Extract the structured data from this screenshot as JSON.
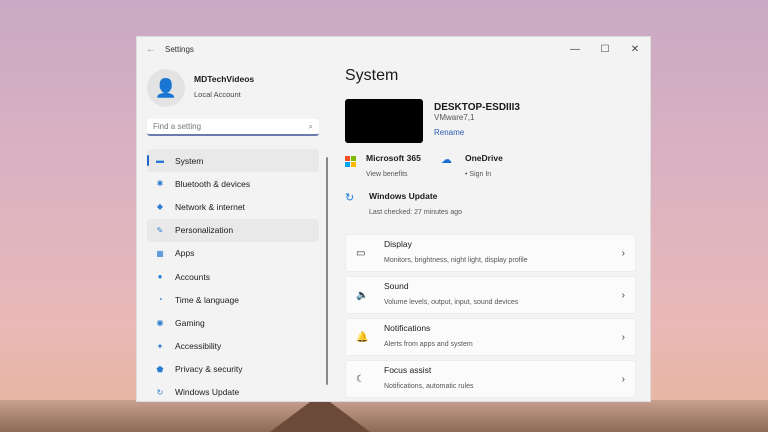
{
  "window": {
    "title": "Settings",
    "back": "←",
    "minimize": "—",
    "maximize": "☐",
    "close": "✕"
  },
  "profile": {
    "name": "MDTechVideos",
    "type": "Local Account"
  },
  "search": {
    "placeholder": "Find a setting"
  },
  "nav": [
    {
      "label": "System",
      "icon": "▬"
    },
    {
      "label": "Bluetooth & devices",
      "icon": "✱"
    },
    {
      "label": "Network & internet",
      "icon": "◆"
    },
    {
      "label": "Personalization",
      "icon": "✎"
    },
    {
      "label": "Apps",
      "icon": "▦"
    },
    {
      "label": "Accounts",
      "icon": "●"
    },
    {
      "label": "Time & language",
      "icon": "◔"
    },
    {
      "label": "Gaming",
      "icon": "◉"
    },
    {
      "label": "Accessibility",
      "icon": "✦"
    },
    {
      "label": "Privacy & security",
      "icon": "⬟"
    },
    {
      "label": "Windows Update",
      "icon": "↻"
    }
  ],
  "main": {
    "title": "System",
    "device": {
      "name": "DESKTOP-ESDIII3",
      "model": "VMware7,1",
      "rename": "Rename"
    },
    "ms365": {
      "title": "Microsoft 365",
      "sub": "View benefits"
    },
    "onedrive": {
      "title": "OneDrive",
      "sub": "• Sign In"
    },
    "update": {
      "title": "Windows Update",
      "sub": "Last checked: 27 minutes ago"
    },
    "cards": [
      {
        "title": "Display",
        "sub": "Monitors, brightness, night light, display profile",
        "icon": "▭"
      },
      {
        "title": "Sound",
        "sub": "Volume levels, output, input, sound devices",
        "icon": "🔈"
      },
      {
        "title": "Notifications",
        "sub": "Alerts from apps and system",
        "icon": "🔔"
      },
      {
        "title": "Focus assist",
        "sub": "Notifications, automatic rules",
        "icon": "☾"
      }
    ]
  }
}
